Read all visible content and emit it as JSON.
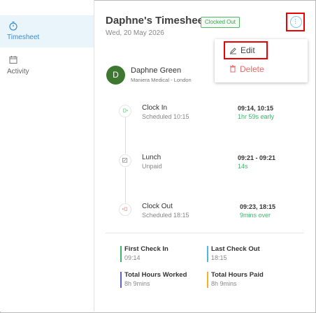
{
  "sidebar": {
    "items": [
      {
        "label": "Timesheet",
        "icon": "stopwatch-icon",
        "active": true
      },
      {
        "label": "Activity",
        "icon": "calendar-icon",
        "active": false
      }
    ]
  },
  "header": {
    "title": "Daphne's Timesheet",
    "status_badge": "Clocked Out",
    "date": "Wed, 20 May 2026"
  },
  "menu": {
    "items": [
      {
        "label": "Edit",
        "icon": "pencil-icon"
      },
      {
        "label": "Delete",
        "icon": "trash-icon"
      }
    ]
  },
  "employee": {
    "initial": "D",
    "name": "Daphne Green",
    "org": "Maniera Medical - London"
  },
  "timeline": [
    {
      "title": "Clock In",
      "subtitle": "Scheduled 10:15",
      "time": "09:14, 10:15",
      "diff": "1hr 59s early",
      "icon": "clock-in-icon"
    },
    {
      "title": "Lunch",
      "subtitle": "Unpaid",
      "time": "09:21 - 09:21",
      "diff": "14s",
      "icon": "lunch-icon"
    },
    {
      "title": "Clock Out",
      "subtitle": "Scheduled 18:15",
      "time": "09:23, 18:15",
      "diff": "9mins over",
      "icon": "clock-out-icon"
    }
  ],
  "stats": [
    {
      "label": "First Check In",
      "value": "09:14"
    },
    {
      "label": "Last Check Out",
      "value": "18:15"
    },
    {
      "label": "Total Hours Worked",
      "value": "8h 9mins"
    },
    {
      "label": "Total Hours Paid",
      "value": "8h 9mins"
    }
  ],
  "colors": {
    "accent": "#3a8fd0",
    "badge_green": "#3aa352",
    "success_text": "#3bb66a",
    "delete_red": "#e66a6a",
    "avatar_bg": "#3e7730",
    "stat_first_check_in": "#3bb66a",
    "stat_last_check_out": "#4fb6e8",
    "stat_total_worked": "#5a63c9",
    "stat_total_paid": "#f0b323"
  }
}
